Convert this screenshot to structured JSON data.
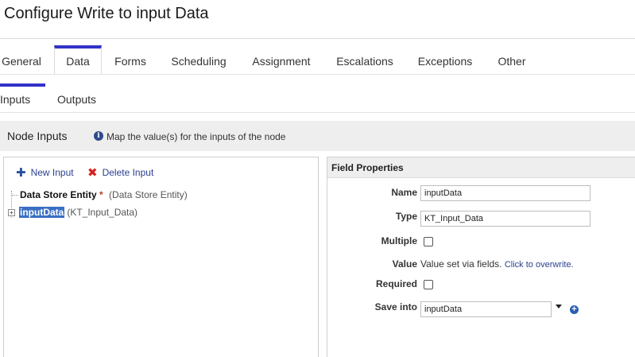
{
  "page": {
    "title": "Configure Write to input Data"
  },
  "tabs": [
    "General",
    "Data",
    "Forms",
    "Scheduling",
    "Assignment",
    "Escalations",
    "Exceptions",
    "Other"
  ],
  "active_tab": "Data",
  "subtabs": [
    "Inputs",
    "Outputs"
  ],
  "active_subtab": "Inputs",
  "section": {
    "title": "Node Inputs",
    "hint": "Map the value(s) for the inputs of the node",
    "info_icon": "i"
  },
  "toolbar": {
    "new_input": "New Input",
    "delete_input": "Delete Input"
  },
  "tree": {
    "items": [
      {
        "name": "Data Store Entity",
        "required_mark": "*",
        "type": "(Data Store Entity)"
      },
      {
        "name": "inputData",
        "type": "(KT_Input_Data)",
        "expander": "+"
      }
    ]
  },
  "field_properties": {
    "title": "Field Properties",
    "name_label": "Name",
    "name_value": "inputData",
    "type_label": "Type",
    "type_value": "KT_Input_Data",
    "multiple_label": "Multiple",
    "multiple_checked": false,
    "value_label": "Value",
    "value_text": "Value set via fields.",
    "value_link": "Click to overwrite.",
    "required_label": "Required",
    "required_checked": false,
    "save_into_label": "Save into",
    "save_into_value": "inputData",
    "add_symbol": "+"
  },
  "colors": {
    "accent": "#3232c8",
    "link": "#2a3f8f",
    "delete": "#d52020",
    "selection": "#3a6fc4"
  }
}
